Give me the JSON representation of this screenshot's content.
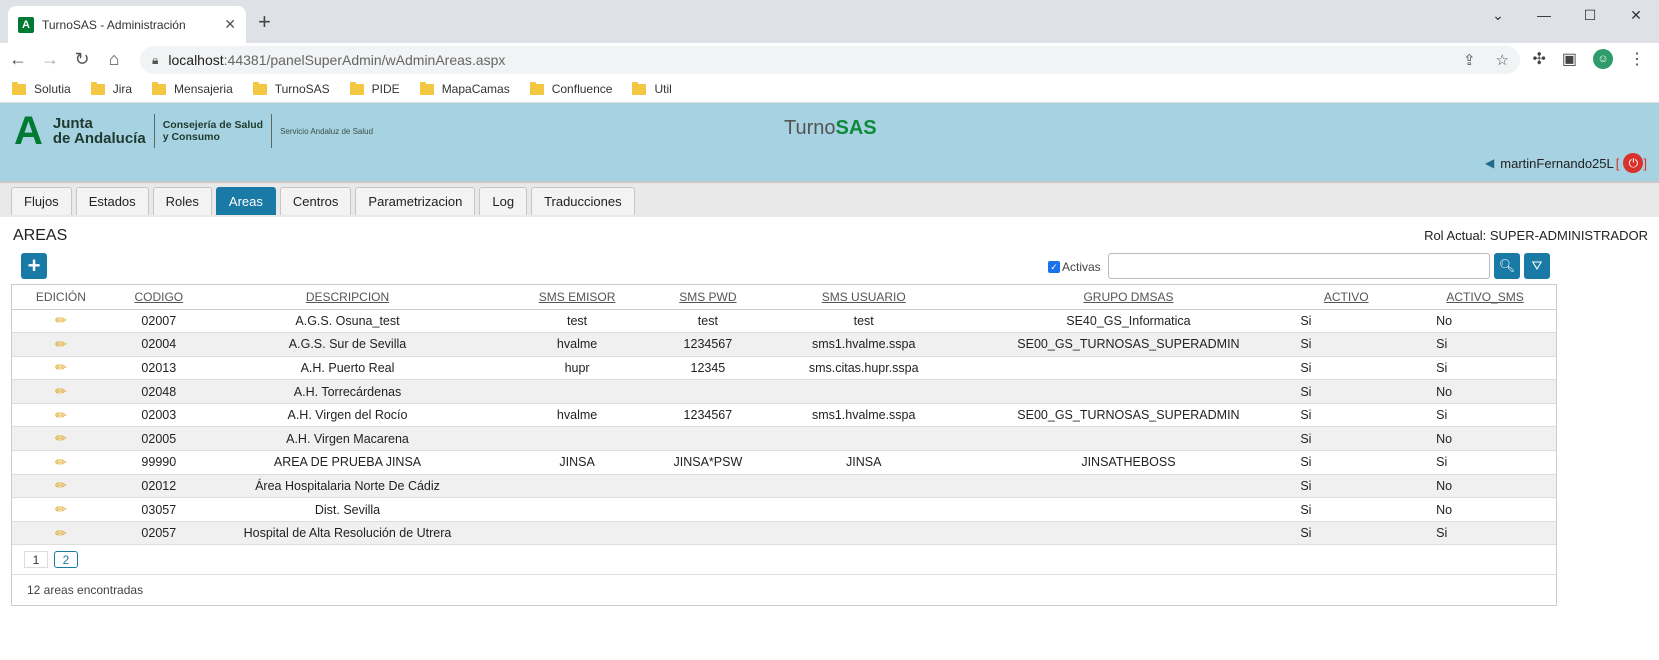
{
  "browser": {
    "tab_title": "TurnoSAS - Administración",
    "tab_favicon": "A",
    "new_tab": "+",
    "url_host": "localhost",
    "url_rest": ":44381/panelSuperAdmin/wAdminAreas.aspx",
    "bookmarks": [
      "Solutia",
      "Jira",
      "Mensajeria",
      "TurnoSAS",
      "PIDE",
      "MapaCamas",
      "Confluence",
      "Util"
    ]
  },
  "header": {
    "logo_line1": "Junta",
    "logo_line2": "de Andalucía",
    "consejeria_line1": "Consejería de Salud",
    "consejeria_line2": "y Consumo",
    "servicio": "Servicio Andaluz de Salud",
    "brand_prefix": "Turno",
    "brand_suffix": "SAS",
    "user": "martinFernando25L"
  },
  "menu_tabs": [
    "Flujos",
    "Estados",
    "Roles",
    "Areas",
    "Centros",
    "Parametrizacion",
    "Log",
    "Traducciones"
  ],
  "active_tab": "Areas",
  "page": {
    "title": "AREAS",
    "rol_label": "Rol Actual: SUPER-ADMINISTRADOR",
    "activas_label": "Activas",
    "add_button": "+"
  },
  "table": {
    "columns": [
      "EDICIÓN",
      "CODIGO",
      "DESCRIPCION",
      "SMS EMISOR",
      "SMS PWD",
      "SMS USUARIO",
      "GRUPO DMSAS",
      "ACTIVO",
      "ACTIVO_SMS"
    ],
    "rows": [
      [
        "02007",
        "A.G.S. Osuna_test",
        "test",
        "test",
        "test",
        "SE40_GS_Informatica",
        "Si",
        "No"
      ],
      [
        "02004",
        "A.G.S. Sur de Sevilla",
        "hvalme",
        "1234567",
        "sms1.hvalme.sspa",
        "SE00_GS_TURNOSAS_SUPERADMIN",
        "Si",
        "Si"
      ],
      [
        "02013",
        "A.H. Puerto Real",
        "hupr",
        "12345",
        "sms.citas.hupr.sspa",
        "",
        "Si",
        "Si"
      ],
      [
        "02048",
        "A.H. Torrecárdenas",
        "",
        "",
        "",
        "",
        "Si",
        "No"
      ],
      [
        "02003",
        "A.H. Virgen del Rocío",
        "hvalme",
        "1234567",
        "sms1.hvalme.sspa",
        "SE00_GS_TURNOSAS_SUPERADMIN",
        "Si",
        "Si"
      ],
      [
        "02005",
        "A.H. Virgen Macarena",
        "",
        "",
        "",
        "",
        "Si",
        "No"
      ],
      [
        "99990",
        "AREA DE PRUEBA JINSA",
        "JINSA",
        "JINSA*PSW",
        "JINSA",
        "JINSATHEBOSS",
        "Si",
        "Si"
      ],
      [
        "02012",
        "Área Hospitalaria Norte De Cádiz",
        "",
        "",
        "",
        "",
        "Si",
        "No"
      ],
      [
        "03057",
        "Dist. Sevilla",
        "",
        "",
        "",
        "",
        "Si",
        "No"
      ],
      [
        "02057",
        "Hospital de Alta Resolución de Utrera",
        "",
        "",
        "",
        "",
        "Si",
        "Si"
      ]
    ]
  },
  "pager": {
    "pages": [
      "1",
      "2"
    ],
    "current": "2"
  },
  "footer": {
    "found": "12 areas encontradas"
  }
}
